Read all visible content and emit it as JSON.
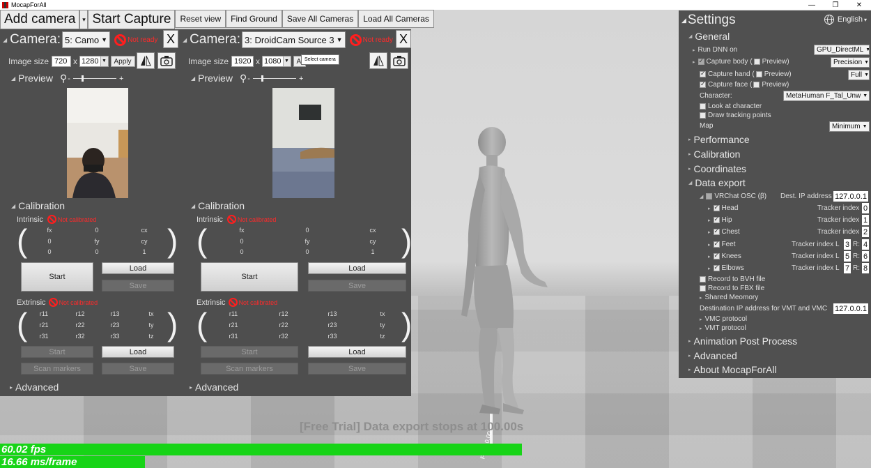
{
  "window": {
    "title": "MocapForAll",
    "buttons": [
      "—",
      "❐",
      "✕"
    ]
  },
  "toolbar": {
    "add_camera": "Add camera",
    "add_camera_caret": "▾",
    "start_capture": "Start Capture",
    "reset_view": "Reset view",
    "find_ground": "Find Ground",
    "save_all": "Save All Cameras",
    "load_all": "Load All Cameras"
  },
  "cameras": [
    {
      "title": "Camera:",
      "source": "5: Camo",
      "status": "Not ready",
      "close": "X",
      "image_size_label": "Image size",
      "width": "720",
      "x": "x",
      "height": "1280",
      "apply": "Apply",
      "preview_label": "Preview",
      "calibration_label": "Calibration",
      "intrinsic_label": "Intrinsic",
      "intrinsic_status": "Not calibrated",
      "intrinsic": [
        [
          "fx",
          "0",
          "cx"
        ],
        [
          "0",
          "fy",
          "cy"
        ],
        [
          "0",
          "0",
          "1"
        ]
      ],
      "start": "Start",
      "load": "Load",
      "save": "Save",
      "extrinsic_label": "Extrinsic",
      "extrinsic_status": "Not calibrated",
      "extrinsic": [
        [
          "r11",
          "r12",
          "r13",
          "tx"
        ],
        [
          "r21",
          "r22",
          "r23",
          "ty"
        ],
        [
          "r31",
          "r32",
          "r33",
          "tz"
        ]
      ],
      "ext_start": "Start",
      "ext_load": "Load",
      "scan_markers": "Scan markers",
      "ext_save": "Save",
      "advanced_label": "Advanced"
    },
    {
      "title": "Camera:",
      "source": "3: DroidCam Source 3",
      "status": "Not ready",
      "close": "X",
      "image_size_label": "Image size",
      "width": "1920",
      "x": "x",
      "height": "1080",
      "apply": "Apply",
      "tooltip": "Select camera",
      "preview_label": "Preview",
      "calibration_label": "Calibration",
      "intrinsic_label": "Intrinsic",
      "intrinsic_status": "Not calibrated",
      "intrinsic": [
        [
          "fx",
          "0",
          "cx"
        ],
        [
          "0",
          "fy",
          "cy"
        ],
        [
          "0",
          "0",
          "1"
        ]
      ],
      "start": "Start",
      "load": "Load",
      "save": "Save",
      "extrinsic_label": "Extrinsic",
      "extrinsic_status": "Not calibrated",
      "extrinsic": [
        [
          "r11",
          "r12",
          "r13",
          "tx"
        ],
        [
          "r21",
          "r22",
          "r23",
          "ty"
        ],
        [
          "r31",
          "r32",
          "r33",
          "tz"
        ]
      ],
      "ext_start": "Start",
      "ext_load": "Load",
      "scan_markers": "Scan markers",
      "ext_save": "Save",
      "advanced_label": "Advanced"
    }
  ],
  "viewport": {
    "trial_notice": "[Free Trial] Data export stops at 100.00s",
    "axis_text": "Front 0.00"
  },
  "settings": {
    "title": "Settings",
    "language": "English",
    "general": "General",
    "run_dnn_on": "Run DNN on",
    "run_dnn_value": "GPU_DirectML",
    "capture_body": "Capture body (",
    "capture_body_value": "Precision",
    "capture_hand": "Capture hand (",
    "capture_hand_value": "Full",
    "capture_face": "Capture face (",
    "preview_word": "Preview)",
    "character_label": "Character:",
    "character_value": "MetaHuman F_Tal_Unw",
    "look_at_character": "Look at character",
    "draw_tracking_points": "Draw tracking points",
    "map_label": "Map",
    "map_value": "Minimum",
    "performance": "Performance",
    "calibration": "Calibration",
    "coordinates": "Coordinates",
    "data_export": "Data export",
    "vrchat_osc": "VRChat OSC (β)",
    "dest_ip_label": "Dest. IP address",
    "dest_ip": "127.0.0.1",
    "tracker_index": "Tracker index",
    "trackers": [
      {
        "name": "Head",
        "index": "0"
      },
      {
        "name": "Hip",
        "index": "1"
      },
      {
        "name": "Chest",
        "index": "2"
      },
      {
        "name": "Feet",
        "l": "3",
        "r": "4"
      },
      {
        "name": "Knees",
        "l": "5",
        "r": "6"
      },
      {
        "name": "Elbows",
        "l": "7",
        "r": "8"
      }
    ],
    "L": "L",
    "R": "R:",
    "record_bvh": "Record to BVH file",
    "record_fbx": "Record to FBX file",
    "shared_memory": "Shared Meomory",
    "dest_ip_vmt_label": "Destination IP address for VMT and VMC",
    "dest_ip_vmt": "127.0.0.1",
    "vmc_protocol": "VMC protocol",
    "vmt_protocol": "VMT protocol",
    "animation_post_process": "Animation Post Process",
    "advanced": "Advanced",
    "about": "About MocapForAll"
  },
  "stats": {
    "fps": "60.02 fps",
    "fps_value": 60.02,
    "ms_frame": "16.66 ms/frame",
    "ms_frame_value": 16.66
  },
  "colors": {
    "accent_green": "#17d417",
    "not_ready_red": "#ff2a2a",
    "panel_gray": "#4e4e4e"
  }
}
